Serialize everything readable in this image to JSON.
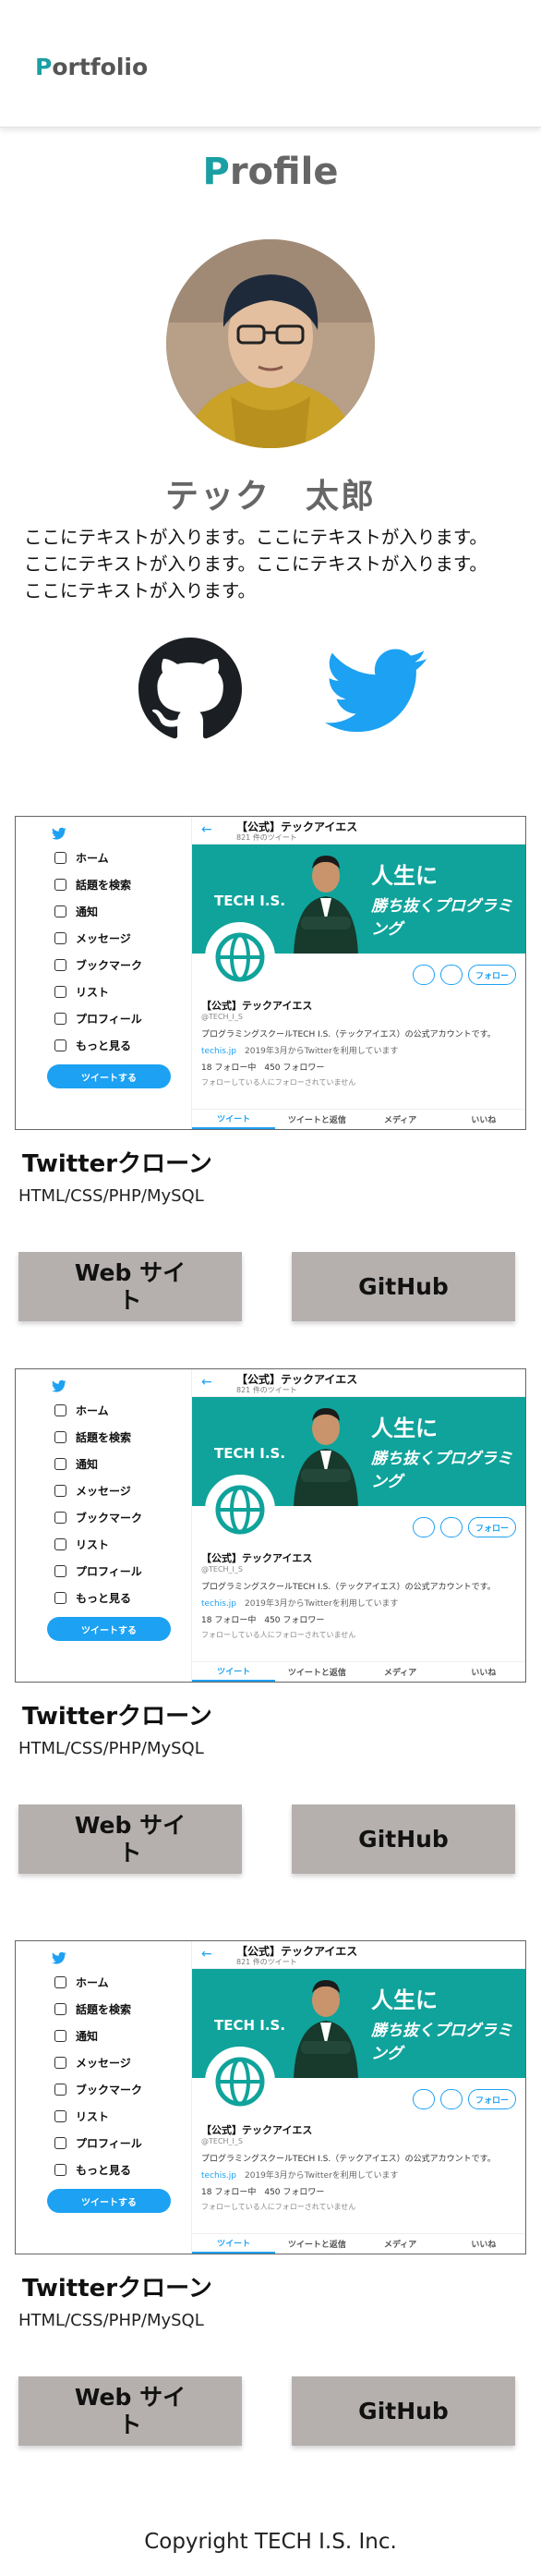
{
  "header": {
    "logo_first": "P",
    "logo_rest": "ortfolio"
  },
  "profile": {
    "title_first": "P",
    "title_rest": "rofile",
    "name": "テック　太郎",
    "lines": [
      "ここにテキストが入ります。ここにテキストが入ります。",
      "ここにテキストが入ります。ここにテキストが入ります。",
      "ここにテキストが入ります。"
    ]
  },
  "social": [
    {
      "icon": "github-icon"
    },
    {
      "icon": "twitter-icon"
    }
  ],
  "colors": {
    "accent": "#1a9fa3",
    "twitter_blue": "#1da1f2",
    "button_bg": "#b5b0ae"
  },
  "shot": {
    "menu": [
      "ホーム",
      "話題を検索",
      "通知",
      "メッセージ",
      "ブックマーク",
      "リスト",
      "プロフィール",
      "もっと見る"
    ],
    "tweet_button": "ツイートする",
    "account_name": "【公式】テックアイエス",
    "tweet_count": "821 件のツイート",
    "brand": "TECH I.S.",
    "banner_copy1": "人生に",
    "banner_copy2": "勝ち抜くプログラミング",
    "follow": "フォロー",
    "handle": "@TECH_I_S",
    "bio": "プログラミングスクールTECH I.S.（テックアイエス）の公式アカウントです。",
    "link": "techis.jp",
    "joined": "2019年3月からTwitterを利用しています",
    "following": "18 フォロー中",
    "followers": "450 フォロワー",
    "note": "フォローしている人にフォローされていません",
    "tabs": [
      "ツイート",
      "ツイートと返信",
      "メディア",
      "いいね"
    ]
  },
  "works": [
    {
      "title": "Twitterクローン",
      "tech": "HTML/CSS/PHP/MySQL",
      "web_label": "Web サイト",
      "github_label": "GitHub"
    },
    {
      "title": "Twitterクローン",
      "tech": "HTML/CSS/PHP/MySQL",
      "web_label": "Web サイト",
      "github_label": "GitHub"
    },
    {
      "title": "Twitterクローン",
      "tech": "HTML/CSS/PHP/MySQL",
      "web_label": "Web サイト",
      "github_label": "GitHub"
    }
  ],
  "footer": {
    "copyright": "Copyright TECH I.S. Inc."
  }
}
